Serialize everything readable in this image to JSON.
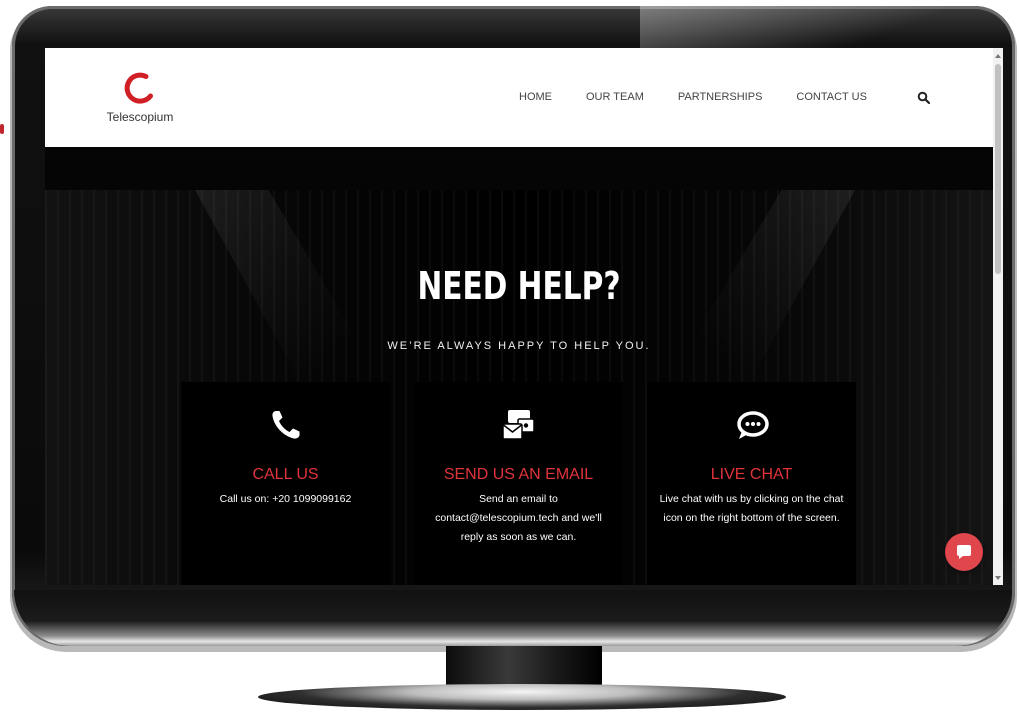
{
  "brand": {
    "name": "Telescopium",
    "accent_color": "#e0343c"
  },
  "nav": {
    "items": [
      {
        "label": "HOME"
      },
      {
        "label": "OUR TEAM"
      },
      {
        "label": "PARTNERSHIPS"
      },
      {
        "label": "CONTACT US"
      }
    ],
    "search_icon": "search-icon"
  },
  "hero": {
    "title": "NEED HELP?",
    "subtitle": "WE’RE ALWAYS HAPPY TO HELP YOU."
  },
  "cards": [
    {
      "icon": "phone-icon",
      "title": "CALL US",
      "text": "Call us on: +20 1099099162"
    },
    {
      "icon": "email-icon",
      "title": "SEND US AN EMAIL",
      "text": "Send an email to contact@telescopium.tech and we'll reply as soon as we can."
    },
    {
      "icon": "chat-bubble-icon",
      "title": "LIVE CHAT",
      "text": "Live chat with us by clicking on the chat icon on the right bottom of the screen."
    }
  ],
  "chat_widget": {
    "icon": "chat-icon",
    "color": "#e0474c"
  }
}
